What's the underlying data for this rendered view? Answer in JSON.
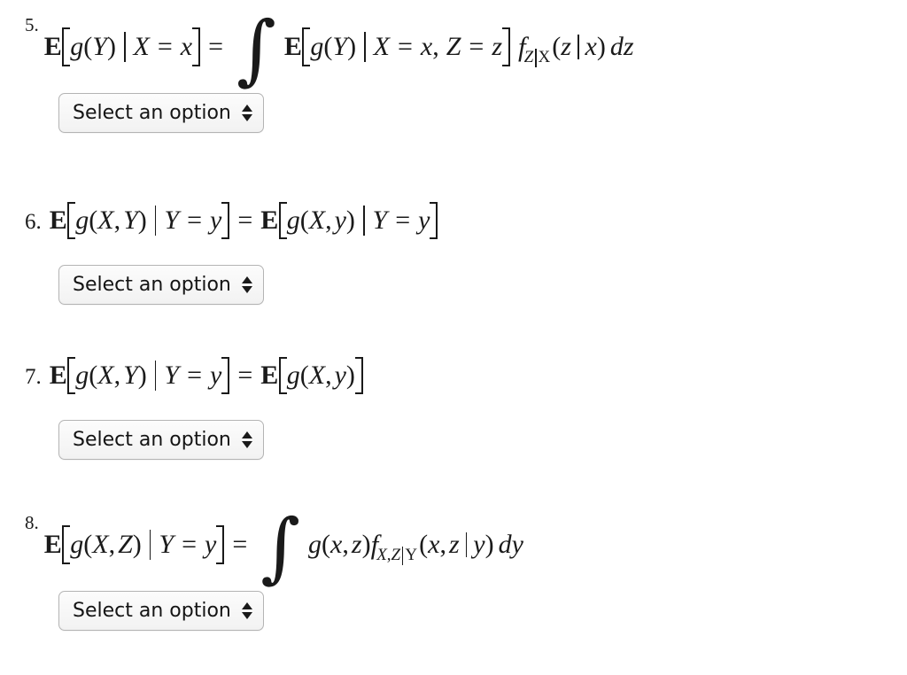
{
  "page": {
    "background_color": "#ffffff",
    "text_color": "#1a1a1a"
  },
  "select_control": {
    "placeholder": "Select an option",
    "icon": "updown-spinner-icon",
    "border_color": "#b4b4b4",
    "background_color": "#f4f4f4"
  },
  "items": [
    {
      "number": "5.",
      "formula_text": "E[g(Y) | X = x] = ∫ E[g(Y) | X = x, Z = z] f_{Z|X}(z | x) dz",
      "tokens": {
        "E1": "E",
        "g1": "g",
        "Y1": "Y",
        "bar1": "|",
        "X1": "X",
        "eq1": "=",
        "x1": "x",
        "eq2": "=",
        "integral": "∫",
        "E2": "E",
        "g2": "g",
        "Y2": "Y",
        "bar2": "|",
        "X2": "X",
        "eq3": "=",
        "x2": "x",
        "comma1": ",",
        "Z1": "Z",
        "eq4": "=",
        "z1": "z",
        "f": "f",
        "subZ": "Z",
        "subbar": "|",
        "subX": "X",
        "argz": "z",
        "argbar": "|",
        "argx": "x",
        "diff": "dz"
      },
      "select_value": "Select an option"
    },
    {
      "number": "6.",
      "formula_text": "E[g(X,Y) | Y = y] = E[g(X,y) | Y = y]",
      "tokens": {
        "E1": "E",
        "g1": "g",
        "X1": "X",
        "comma1": ",",
        "Y1": "Y",
        "bar1": "|",
        "Y2": "Y",
        "eq1": "=",
        "y1": "y",
        "eq2": "=",
        "E2": "E",
        "g2": "g",
        "X2": "X",
        "comma2": ",",
        "y2": "y",
        "bar2": "|",
        "Y3": "Y",
        "eq3": "=",
        "y3": "y"
      },
      "select_value": "Select an option"
    },
    {
      "number": "7.",
      "formula_text": "E[g(X,Y) | Y = y] = E[g(X,y)]",
      "tokens": {
        "E1": "E",
        "g1": "g",
        "X1": "X",
        "comma1": ",",
        "Y1": "Y",
        "bar1": "|",
        "Y2": "Y",
        "eq1": "=",
        "y1": "y",
        "eq2": "=",
        "E2": "E",
        "g2": "g",
        "X2": "X",
        "comma2": ",",
        "y2": "y"
      },
      "select_value": "Select an option"
    },
    {
      "number": "8.",
      "formula_text": "E[g(X,Z) | Y = y] = ∫ g(x,z) f_{X,Z|Y}(x, z | y) dy",
      "tokens": {
        "E1": "E",
        "g1": "g",
        "X1": "X",
        "comma1": ",",
        "Z1": "Z",
        "bar1": "|",
        "Y1": "Y",
        "eq1": "=",
        "y1": "y",
        "eq2": "=",
        "integral": "∫",
        "g2": "g",
        "x1": "x",
        "comma2": ",",
        "z1": "z",
        "f": "f",
        "subX": "X",
        "subcomma": ",",
        "subZ": "Z",
        "subbar": "|",
        "subY": "Y",
        "argx": "x",
        "argcomma": ",",
        "argz": "z",
        "argbar": "|",
        "argy": "y",
        "diff": "dy"
      },
      "select_value": "Select an option"
    }
  ]
}
